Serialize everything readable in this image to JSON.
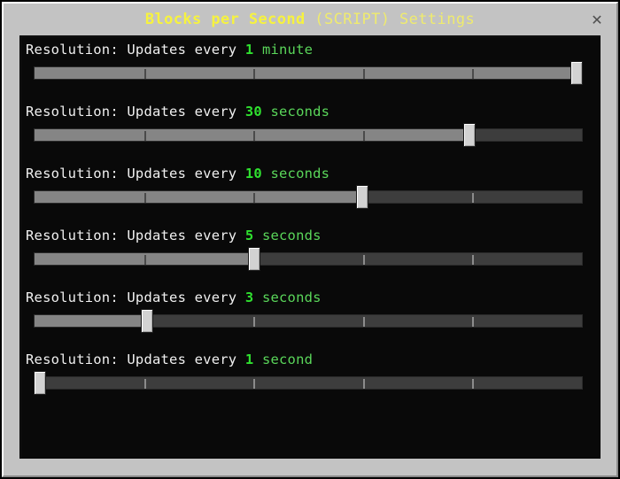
{
  "window": {
    "title_bold": "Blocks per Second",
    "title_light": " (SCRIPT) Settings",
    "close_icon": "✕"
  },
  "colors": {
    "frame": "#c3c3c3",
    "content_bg": "#090909",
    "title_yellow": "#f6f23f",
    "label_white": "#f0f0f0",
    "value_green": "#2fe02f",
    "unit_green": "#5ad65a",
    "track_filled": "#858585",
    "track_empty": "#3d3d3d",
    "handle": "#d2d2d2"
  },
  "settings": [
    {
      "label_prefix": "Resolution: Updates every",
      "value": "1",
      "unit": "minute",
      "percent": 100,
      "ticks": 4
    },
    {
      "label_prefix": "Resolution: Updates every",
      "value": "30",
      "unit": "seconds",
      "percent": 80,
      "ticks": 4
    },
    {
      "label_prefix": "Resolution: Updates every",
      "value": "10",
      "unit": "seconds",
      "percent": 60,
      "ticks": 4
    },
    {
      "label_prefix": "Resolution: Updates every",
      "value": "5",
      "unit": "seconds",
      "percent": 40,
      "ticks": 4
    },
    {
      "label_prefix": "Resolution: Updates every",
      "value": "3",
      "unit": "seconds",
      "percent": 20,
      "ticks": 4
    },
    {
      "label_prefix": "Resolution: Updates every",
      "value": "1",
      "unit": "second",
      "percent": 0,
      "ticks": 4
    }
  ]
}
